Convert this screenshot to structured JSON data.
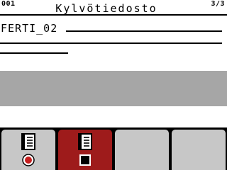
{
  "header": {
    "left_code": "001",
    "title": "Kylvötiedosto",
    "page_indicator": "3/3"
  },
  "field": {
    "value": "FERTI_02"
  },
  "softkeys": [
    {
      "icon": "document-icon",
      "state_icon": "record-icon",
      "active": false
    },
    {
      "icon": "document-icon",
      "state_icon": "stop-icon",
      "active": true
    },
    {
      "icon": "",
      "state_icon": "",
      "active": false
    },
    {
      "icon": "",
      "state_icon": "",
      "active": false
    }
  ],
  "colors": {
    "active_softkey": "#9e1b1b",
    "inactive_softkey": "#c7c7c7",
    "gray_band": "#a6a6a6",
    "record_red": "#c61f1f"
  }
}
